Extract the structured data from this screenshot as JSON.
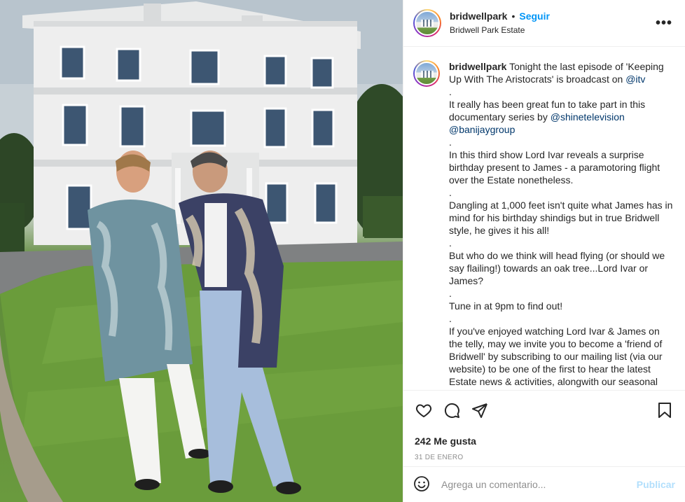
{
  "post": {
    "username": "bridwellpark",
    "follow_label": "Seguir",
    "separator": "•",
    "location": "Bridwell Park Estate",
    "more_label": "•••",
    "image_alt": "Two men in ornate paisley coats standing on the lawn in front of a white Georgian house"
  },
  "caption": {
    "username": "bridwellpark",
    "segments": [
      {
        "text": "Tonight the last episode of 'Keeping Up With The Aristocrats' is broadcast on ",
        "type": "text"
      },
      {
        "text": "@itv",
        "type": "mention"
      },
      {
        "text": "\n.\nIt really has been great fun to take part in this documentary series by ",
        "type": "text"
      },
      {
        "text": "@shinetelevision",
        "type": "mention"
      },
      {
        "text": "\n",
        "type": "text"
      },
      {
        "text": "@banijaygroup",
        "type": "mention"
      },
      {
        "text": "\n.\nIn this third show Lord Ivar reveals a surprise birthday present to James - a paramotoring flight over the Estate nonetheless.\n.\nDangling at 1,000 feet isn't quite what James has in mind for his birthday shindigs but in true Bridwell style, he gives it his all!\n.\nBut who do we think will head flying (or should we say flailing!) towards an oak tree...Lord Ivar or James?\n.\nTune in at 9pm to find out!\n.\nIf you've enjoyed watching Lord Ivar & James on the telly, may we invite you to become a 'friend of Bridwell' by subscribing to our mailing list (via our website) to be one of the first to hear the latest Estate news & activities, alongwith our seasonal",
        "type": "text"
      }
    ]
  },
  "actions": {
    "like_icon": "heart-icon",
    "comment_icon": "comment-icon",
    "share_icon": "paper-plane-icon",
    "save_icon": "bookmark-icon"
  },
  "likes_label": "242 Me gusta",
  "date_label": "31 DE ENERO",
  "comment": {
    "placeholder": "Agrega un comentario...",
    "post_label": "Publicar",
    "emoji_icon": "smiley-icon"
  },
  "colors": {
    "accent": "#0095f6",
    "mention": "#00376b",
    "post_disabled": "#b2dffc",
    "muted": "#8e8e8e"
  }
}
